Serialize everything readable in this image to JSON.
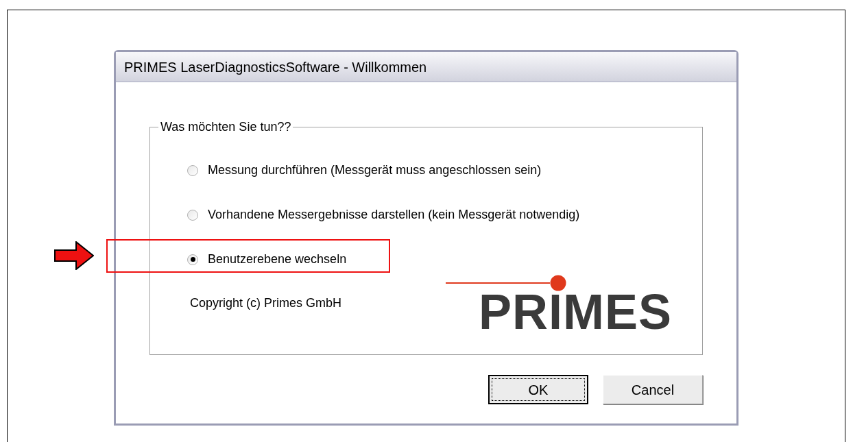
{
  "window": {
    "title": "PRIMES LaserDiagnosticsSoftware - Willkommen"
  },
  "group": {
    "legend": "Was möchten Sie tun??",
    "options": [
      {
        "label": "Messung durchführen (Messgerät muss angeschlossen sein)",
        "selected": false,
        "highlighted": false
      },
      {
        "label": "Vorhandene Messergebnisse darstellen (kein Messgerät notwendig)",
        "selected": false,
        "highlighted": false
      },
      {
        "label": "Benutzerebene wechseln",
        "selected": true,
        "highlighted": true
      }
    ]
  },
  "copyright": "Copyright (c) Primes GmbH",
  "logo": {
    "text": "PRIMES"
  },
  "buttons": [
    {
      "label": "OK",
      "default": true
    },
    {
      "label": "Cancel",
      "default": false
    }
  ]
}
